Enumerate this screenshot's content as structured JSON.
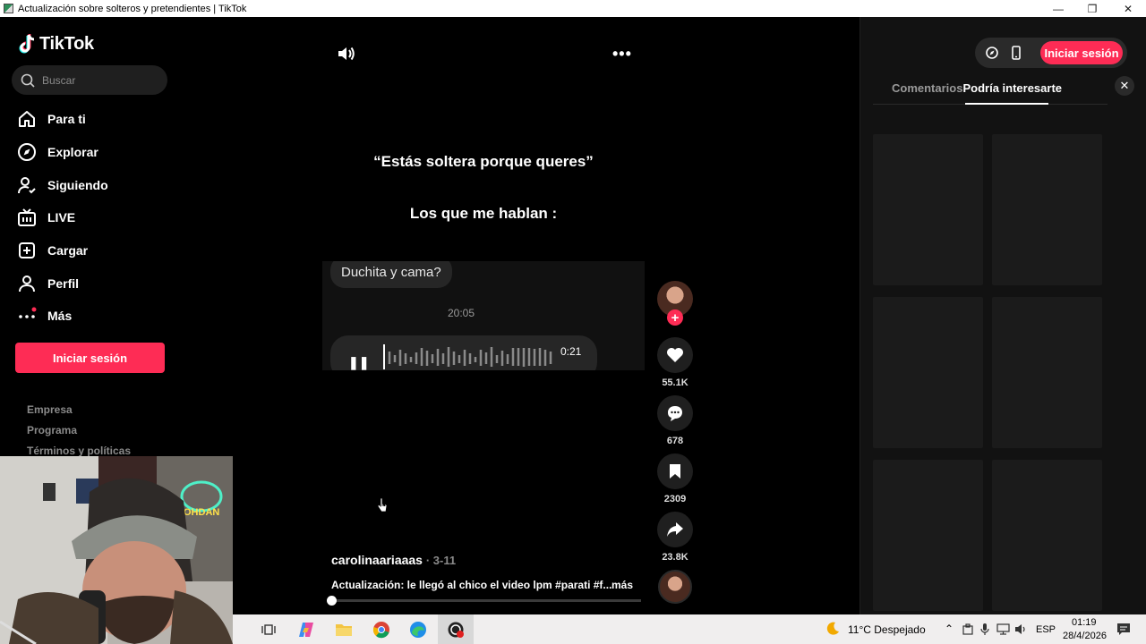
{
  "window": {
    "title": "Actualización sobre solteros y pretendientes | TikTok"
  },
  "sidebar": {
    "logo": "TikTok",
    "search_placeholder": "Buscar",
    "nav": [
      {
        "label": "Para ti",
        "icon": "home-icon"
      },
      {
        "label": "Explorar",
        "icon": "compass-icon"
      },
      {
        "label": "Siguiendo",
        "icon": "user-follow-icon"
      },
      {
        "label": "LIVE",
        "icon": "live-tv-icon"
      },
      {
        "label": "Cargar",
        "icon": "upload-plus-icon"
      },
      {
        "label": "Perfil",
        "icon": "profile-icon"
      },
      {
        "label": "Más",
        "icon": "more-dots-icon"
      }
    ],
    "login_button": "Iniciar sesión",
    "footer_links": [
      "Empresa",
      "Programa",
      "Términos y políticas"
    ]
  },
  "video": {
    "overlay_line1": "“Estás soltera porque queres”",
    "overlay_line2": "Los que me hablan :",
    "chat_bubble": "Duchita y cama?",
    "chat_time": "20:05",
    "voice_duration": "0:21",
    "author": "carolinaariaaas",
    "date": "· 3-11",
    "caption": "Actualización: le llegó al chico el video lpm  #parati #f...",
    "more_label": "más",
    "progress": 0.0
  },
  "actions": {
    "likes": "55.1K",
    "comments": "678",
    "saves": "2309",
    "shares": "23.8K"
  },
  "right_panel": {
    "login_button": "Iniciar sesión",
    "tabs": [
      {
        "label": "Comentarios",
        "active": false
      },
      {
        "label": "Podría interesarte",
        "active": true
      }
    ]
  },
  "taskbar": {
    "weather": "11°C  Despejado",
    "language": "ESP",
    "time": "01:19",
    "date": "28/4/2026"
  },
  "colors": {
    "accent": "#fe2c55",
    "background": "#000000",
    "panel": "#121212"
  }
}
